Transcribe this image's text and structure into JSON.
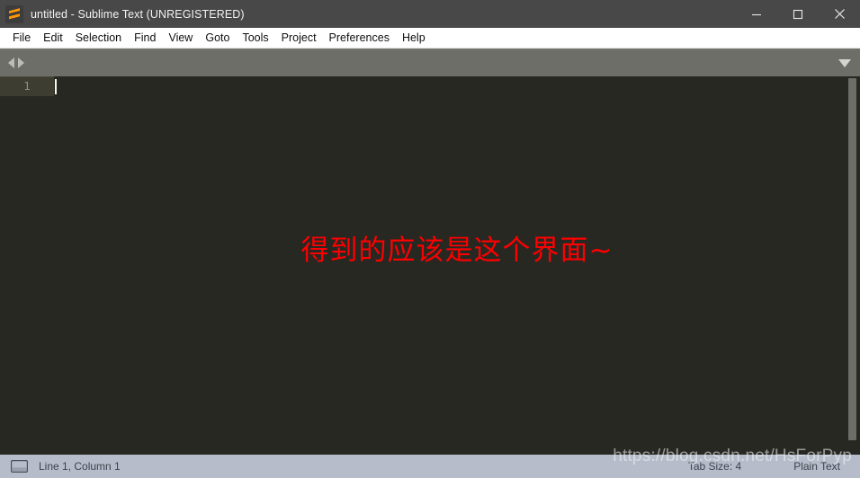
{
  "window": {
    "title": "untitled - Sublime Text (UNREGISTERED)",
    "logo_icon": "sublime-text-logo",
    "controls": {
      "minimize_icon": "minimize-icon",
      "maximize_icon": "maximize-icon",
      "close_icon": "close-icon"
    }
  },
  "menubar": {
    "items": [
      {
        "label": "File"
      },
      {
        "label": "Edit"
      },
      {
        "label": "Selection"
      },
      {
        "label": "Find"
      },
      {
        "label": "View"
      },
      {
        "label": "Goto"
      },
      {
        "label": "Tools"
      },
      {
        "label": "Project"
      },
      {
        "label": "Preferences"
      },
      {
        "label": "Help"
      }
    ]
  },
  "tabbar": {
    "scroll_left_icon": "triangle-left-icon",
    "scroll_right_icon": "triangle-right-icon",
    "tab_list_icon": "chevron-down-icon",
    "tabs": []
  },
  "editor": {
    "line_numbers": [
      "1"
    ],
    "lines": [
      ""
    ],
    "caret_visible": true,
    "overlay_note": "得到的应该是这个界面~",
    "overlay_note_color": "#fe0000",
    "background_color": "#272822",
    "gutter_active_color": "#3e3d32",
    "scrollbar_icon": "vertical-scrollbar"
  },
  "statusbar": {
    "sidebar_toggle_icon": "panel-toggle-icon",
    "cursor_position": "Line 1, Column 1",
    "tab_size": "Tab Size: 4",
    "syntax": "Plain Text"
  },
  "watermark": {
    "text": "https://blog.csdn.net/HsForPyp"
  }
}
